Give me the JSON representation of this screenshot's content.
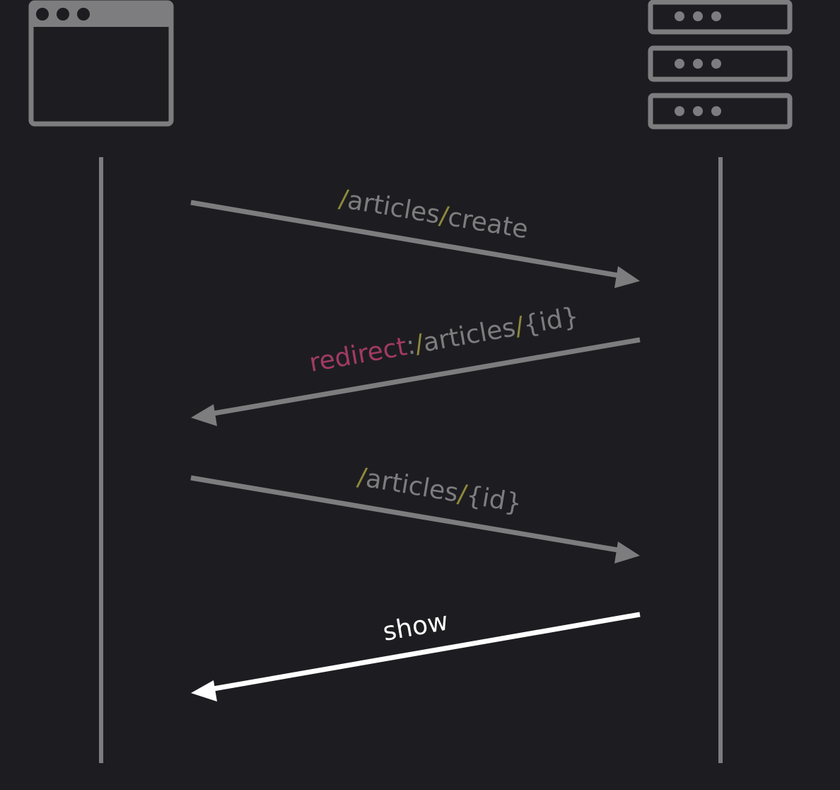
{
  "colors": {
    "background": "#1d1d21",
    "line": "#7d7d7f",
    "slash": "#8e8a3c",
    "redirect": "#a23a62",
    "highlight": "#ffffff"
  },
  "client": {
    "icon": "browser-window-icon"
  },
  "server": {
    "icon": "server-stack-icon"
  },
  "messages": [
    {
      "id": "create-request",
      "direction": "to-server",
      "parts": [
        {
          "text": "/",
          "role": "slash"
        },
        {
          "text": "articles",
          "role": "plain"
        },
        {
          "text": "/",
          "role": "slash"
        },
        {
          "text": "create",
          "role": "plain"
        }
      ]
    },
    {
      "id": "redirect-response",
      "direction": "to-client",
      "parts": [
        {
          "text": "redirect",
          "role": "redirect"
        },
        {
          "text": ":",
          "role": "plain"
        },
        {
          "text": "/",
          "role": "slash"
        },
        {
          "text": "articles",
          "role": "plain"
        },
        {
          "text": "/",
          "role": "slash"
        },
        {
          "text": "{id}",
          "role": "plain"
        }
      ]
    },
    {
      "id": "article-request",
      "direction": "to-server",
      "parts": [
        {
          "text": "/",
          "role": "slash"
        },
        {
          "text": "articles",
          "role": "plain"
        },
        {
          "text": "/",
          "role": "slash"
        },
        {
          "text": "{id}",
          "role": "plain"
        }
      ]
    },
    {
      "id": "show-response",
      "direction": "to-client",
      "highlighted": true,
      "parts": [
        {
          "text": "show",
          "role": "plain"
        }
      ]
    }
  ]
}
